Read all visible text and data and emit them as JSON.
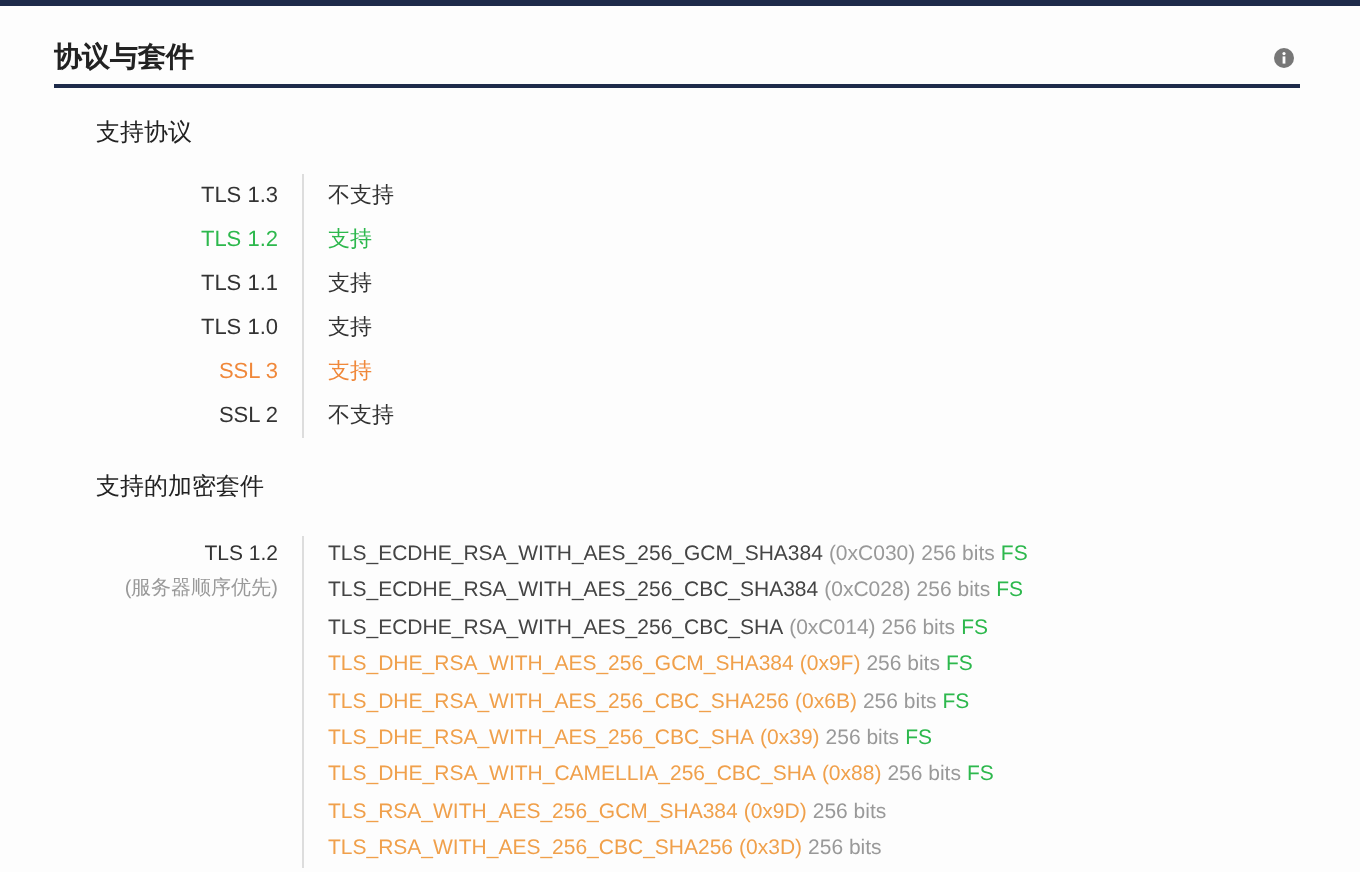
{
  "section": {
    "title": "协议与套件"
  },
  "protocols": {
    "heading": "支持协议",
    "rows": [
      {
        "name": "TLS 1.3",
        "value": "不支持",
        "color": "#333333"
      },
      {
        "name": "TLS 1.2",
        "value": "支持",
        "color": "#2db84d"
      },
      {
        "name": "TLS 1.1",
        "value": "支持",
        "color": "#333333"
      },
      {
        "name": "TLS 1.0",
        "value": "支持",
        "color": "#333333"
      },
      {
        "name": "SSL 3",
        "value": "支持",
        "color": "#f0883a"
      },
      {
        "name": "SSL 2",
        "value": "不支持",
        "color": "#333333"
      }
    ]
  },
  "cipher_suites": {
    "heading": "支持的加密套件",
    "protocol": "TLS 1.2",
    "note": "(服务器顺序优先)",
    "rows": [
      {
        "kind": "plain",
        "name": "TLS_ECDHE_RSA_WITH_AES_256_GCM_SHA384",
        "code": "(0xC030)",
        "bits": "256 bits",
        "fs": "FS",
        "color": "#444444"
      },
      {
        "kind": "plain",
        "name": "TLS_ECDHE_RSA_WITH_AES_256_CBC_SHA384",
        "code": "(0xC028)",
        "bits": "256 bits",
        "fs": "FS",
        "color": "#444444"
      },
      {
        "kind": "plain",
        "name": "TLS_ECDHE_RSA_WITH_AES_256_CBC_SHA",
        "code": "(0xC014)",
        "bits": "256 bits",
        "fs": "FS",
        "color": "#444444"
      },
      {
        "kind": "flagged",
        "name": "TLS_DHE_RSA_WITH_AES_256_GCM_SHA384",
        "code": "(0x9F)",
        "bits": "256 bits",
        "fs": "FS",
        "color": "#f0a04b"
      },
      {
        "kind": "flagged",
        "name": "TLS_DHE_RSA_WITH_AES_256_CBC_SHA256",
        "code": "(0x6B)",
        "bits": "256 bits",
        "fs": "FS",
        "color": "#f0a04b"
      },
      {
        "kind": "flagged",
        "name": "TLS_DHE_RSA_WITH_AES_256_CBC_SHA",
        "code": "(0x39)",
        "bits": "256 bits",
        "fs": "FS",
        "color": "#f0a04b"
      },
      {
        "kind": "flagged",
        "name": "TLS_DHE_RSA_WITH_CAMELLIA_256_CBC_SHA",
        "code": "(0x88)",
        "bits": "256 bits",
        "fs": "FS",
        "color": "#f0a04b"
      },
      {
        "kind": "flagged",
        "name": "TLS_RSA_WITH_AES_256_GCM_SHA384",
        "code": "(0x9D)",
        "bits": "256 bits",
        "color": "#f0a04b"
      },
      {
        "kind": "flagged",
        "name": "TLS_RSA_WITH_AES_256_CBC_SHA256",
        "code": "(0x3D)",
        "bits": "256 bits",
        "color": "#f0a04b"
      }
    ]
  }
}
